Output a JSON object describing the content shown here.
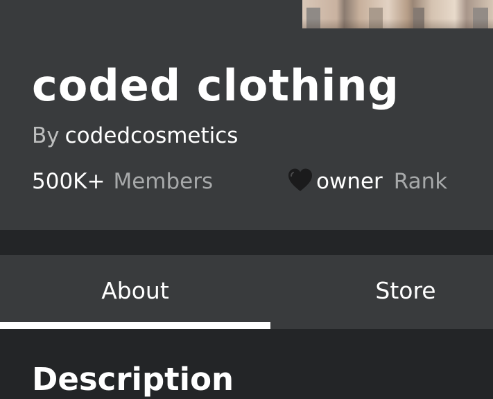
{
  "group": {
    "name": "coded clothing",
    "by_prefix": "By",
    "owner": "codedcosmetics"
  },
  "stats": {
    "members_value": "500K+",
    "members_label": "Members",
    "rank_icon": "black-heart-icon",
    "rank_name": "owner",
    "rank_label": "Rank"
  },
  "tabs": [
    {
      "label": "About",
      "active": true
    },
    {
      "label": "Store",
      "active": false
    }
  ],
  "section": {
    "title": "Description"
  },
  "colors": {
    "background": "#232527",
    "card": "#393b3d",
    "muted_text": "#a7a9aa",
    "text": "#ffffff"
  }
}
